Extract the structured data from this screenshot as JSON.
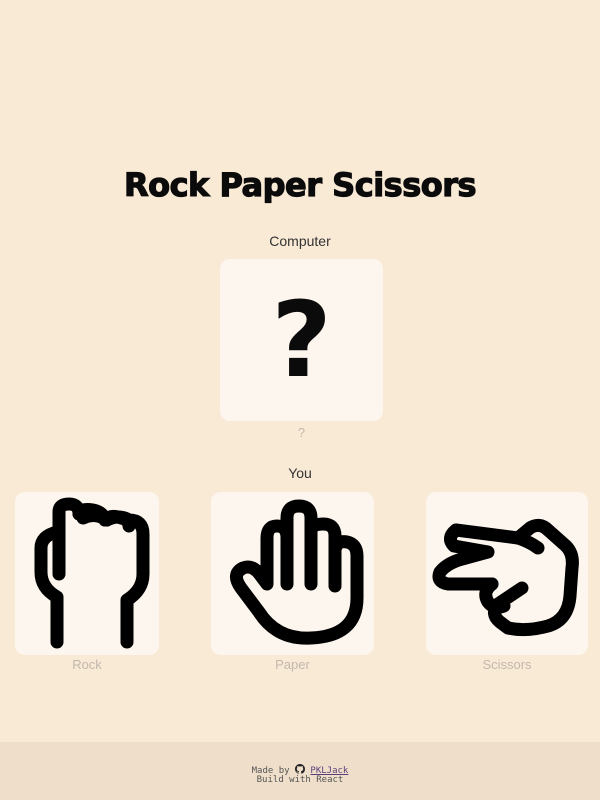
{
  "title": "Rock Paper Scissors",
  "computer": {
    "label": "Computer",
    "choice_symbol": "?",
    "choice_caption": "?"
  },
  "player": {
    "label": "You",
    "choices": [
      {
        "label": "Rock",
        "icon": "fist-icon"
      },
      {
        "label": "Paper",
        "icon": "open-hand-icon"
      },
      {
        "label": "Scissors",
        "icon": "scissors-hand-icon"
      }
    ]
  },
  "footer": {
    "made_by_text": "Made by",
    "author": "PKLJack",
    "build_text": "Build with",
    "framework": "React"
  },
  "colors": {
    "background": "#f9ead6",
    "card": "#fdf6ee",
    "footer": "#efdfca",
    "caption": "#c2b8ad"
  }
}
